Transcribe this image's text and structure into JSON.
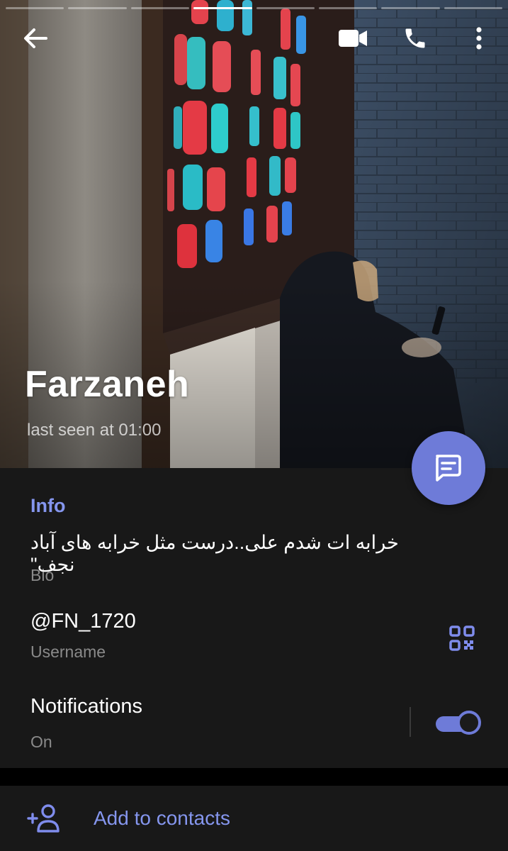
{
  "profile": {
    "name": "Farzaneh",
    "status": "last seen at 01:00"
  },
  "story": {
    "segments": 8,
    "active_index": 3
  },
  "topbar": {
    "icons": [
      "back-arrow-icon",
      "video-call-icon",
      "phone-icon",
      "more-vertical-icon"
    ]
  },
  "info": {
    "title": "Info",
    "bio": "خرابه ات شدم علی..درست مثل خرابه های آباد نجف\"",
    "bio_label": "Bio",
    "username": "@FN_1720",
    "username_label": "Username",
    "notifications": "Notifications",
    "notifications_state": "On"
  },
  "actions": {
    "add_contact": "Add to contacts"
  },
  "colors": {
    "accent": "#6e7bd8",
    "accent_text": "#8596ee",
    "panel_bg": "#181818",
    "secondary_text": "#8a8a8a"
  }
}
